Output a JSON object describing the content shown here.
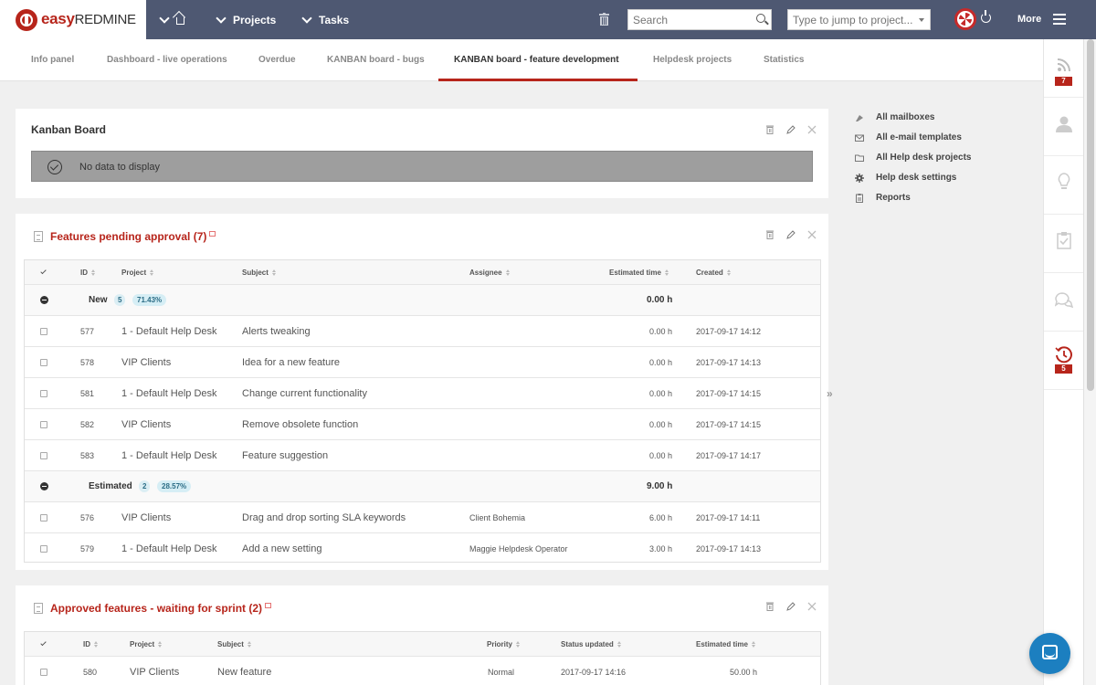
{
  "app": {
    "brand_a": "easy",
    "brand_b": "REDMINE"
  },
  "topnav": {
    "projects": "Projects",
    "tasks": "Tasks",
    "more": "More"
  },
  "search": {
    "placeholder": "Search"
  },
  "jump": {
    "placeholder": "Type to jump to project..."
  },
  "tabs": [
    {
      "label": "Info panel"
    },
    {
      "label": "Dashboard - live operations"
    },
    {
      "label": "Overdue"
    },
    {
      "label": "KANBAN board - bugs"
    },
    {
      "label": "KANBAN board - feature development",
      "active": true
    },
    {
      "label": "Helpdesk projects"
    },
    {
      "label": "Statistics"
    }
  ],
  "right_sidebar": {
    "badge_top": "7",
    "badge_bottom": "5"
  },
  "kanban": {
    "title": "Kanban Board",
    "empty": "No data to display"
  },
  "pending": {
    "title": "Features pending approval (7)",
    "columns": {
      "id": "ID",
      "project": "Project",
      "subject": "Subject",
      "assignee": "Assignee",
      "estimated": "Estimated time",
      "created": "Created"
    },
    "groups": [
      {
        "name": "New",
        "count": "5",
        "percent": "71.43%",
        "total": "0.00 h"
      },
      {
        "name": "Estimated",
        "count": "2",
        "percent": "28.57%",
        "total": "9.00 h"
      }
    ],
    "rows": [
      {
        "id": "577",
        "project": "1 - Default Help Desk",
        "subject": "Alerts tweaking",
        "assignee": "",
        "estimated": "0.00 h",
        "created": "2017-09-17 14:12"
      },
      {
        "id": "578",
        "project": "VIP Clients",
        "subject": "Idea for a new feature",
        "assignee": "",
        "estimated": "0.00 h",
        "created": "2017-09-17 14:13"
      },
      {
        "id": "581",
        "project": "1 - Default Help Desk",
        "subject": "Change current functionality",
        "assignee": "",
        "estimated": "0.00 h",
        "created": "2017-09-17 14:15"
      },
      {
        "id": "582",
        "project": "VIP Clients",
        "subject": "Remove obsolete function",
        "assignee": "",
        "estimated": "0.00 h",
        "created": "2017-09-17 14:15"
      },
      {
        "id": "583",
        "project": "1 - Default Help Desk",
        "subject": "Feature suggestion",
        "assignee": "",
        "estimated": "0.00 h",
        "created": "2017-09-17 14:17"
      },
      {
        "id": "576",
        "project": "VIP Clients",
        "subject": "Drag and drop sorting SLA keywords",
        "assignee": "Client Bohemia",
        "estimated": "6.00 h",
        "created": "2017-09-17 14:11"
      },
      {
        "id": "579",
        "project": "1 - Default Help Desk",
        "subject": "Add a new setting",
        "assignee": "Maggie Helpdesk Operator",
        "estimated": "3.00 h",
        "created": "2017-09-17 14:13"
      }
    ]
  },
  "approved": {
    "title": "Approved features - waiting for sprint (2)",
    "columns": {
      "id": "ID",
      "project": "Project",
      "subject": "Subject",
      "priority": "Priority",
      "status_updated": "Status updated",
      "estimated": "Estimated time"
    },
    "rows": [
      {
        "id": "580",
        "project": "VIP Clients",
        "subject": "New feature",
        "priority": "Normal",
        "status_updated": "2017-09-17 14:16",
        "estimated": "50.00 h"
      }
    ]
  },
  "right_links": [
    {
      "label": "All mailboxes",
      "icon": "mailbox-icon"
    },
    {
      "label": "All e-mail templates",
      "icon": "envelope-icon"
    },
    {
      "label": "All Help desk projects",
      "icon": "folder-icon"
    },
    {
      "label": "Help desk settings",
      "icon": "gear-icon"
    },
    {
      "label": "Reports",
      "icon": "report-icon"
    }
  ]
}
